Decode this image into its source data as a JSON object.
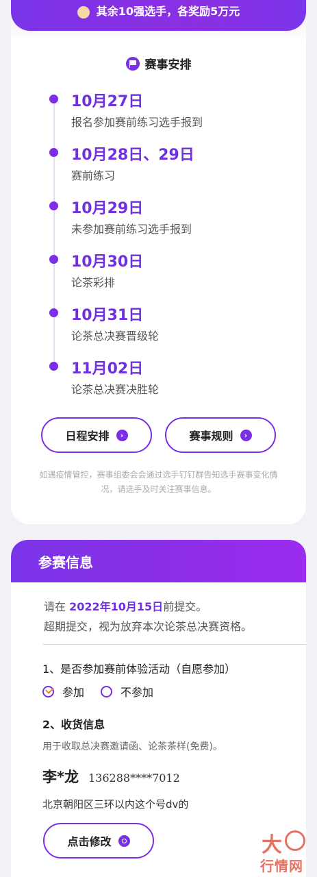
{
  "banner": {
    "text": "其余10强选手，各奖励5万元"
  },
  "schedule": {
    "title": "赛事安排",
    "items": [
      {
        "date": "10月27日",
        "desc": "报名参加赛前练习选手报到"
      },
      {
        "date": "10月28日、29日",
        "desc": "赛前练习"
      },
      {
        "date": "10月29日",
        "desc": "未参加赛前练习选手报到"
      },
      {
        "date": "10月30日",
        "desc": "论茶彩排"
      },
      {
        "date": "10月31日",
        "desc": "论茶总决赛晋级轮"
      },
      {
        "date": "11月02日",
        "desc": "论茶总决赛决胜轮"
      }
    ],
    "buttons": {
      "schedule_label": "日程安排",
      "rules_label": "赛事规则"
    },
    "notice": "如遇疫情管控，赛事组委会会通过选手钉钉群告知选手赛事变化情况，请选手及时关注赛事信息。"
  },
  "entry": {
    "title": "参赛信息",
    "deadline_prefix": "请在",
    "deadline_date": "2022年10月15日",
    "deadline_suffix": "前提交。",
    "deadline_note": "超期提交，视为放弃本次论茶总决赛资格。",
    "q1": "1、是否参加赛前体验活动（自愿参加）",
    "options": [
      "参加",
      "不参加"
    ],
    "selected_option": "参加",
    "q2": "2、收货信息",
    "q2_desc": "用于收取总决赛邀请函、论茶茶样(免费)。",
    "recipient_name": "李*龙",
    "recipient_phone": "136288****7012",
    "address": "北京朝阳区三环以内这个号dv的",
    "edit_label": "点击修改"
  },
  "watermark": {
    "top": "大",
    "bottom": "行情网"
  },
  "colors": {
    "accent": "#7b2ee6",
    "date_text": "#7130df",
    "check": "#e8823a",
    "watermark": "#e25a4a"
  }
}
